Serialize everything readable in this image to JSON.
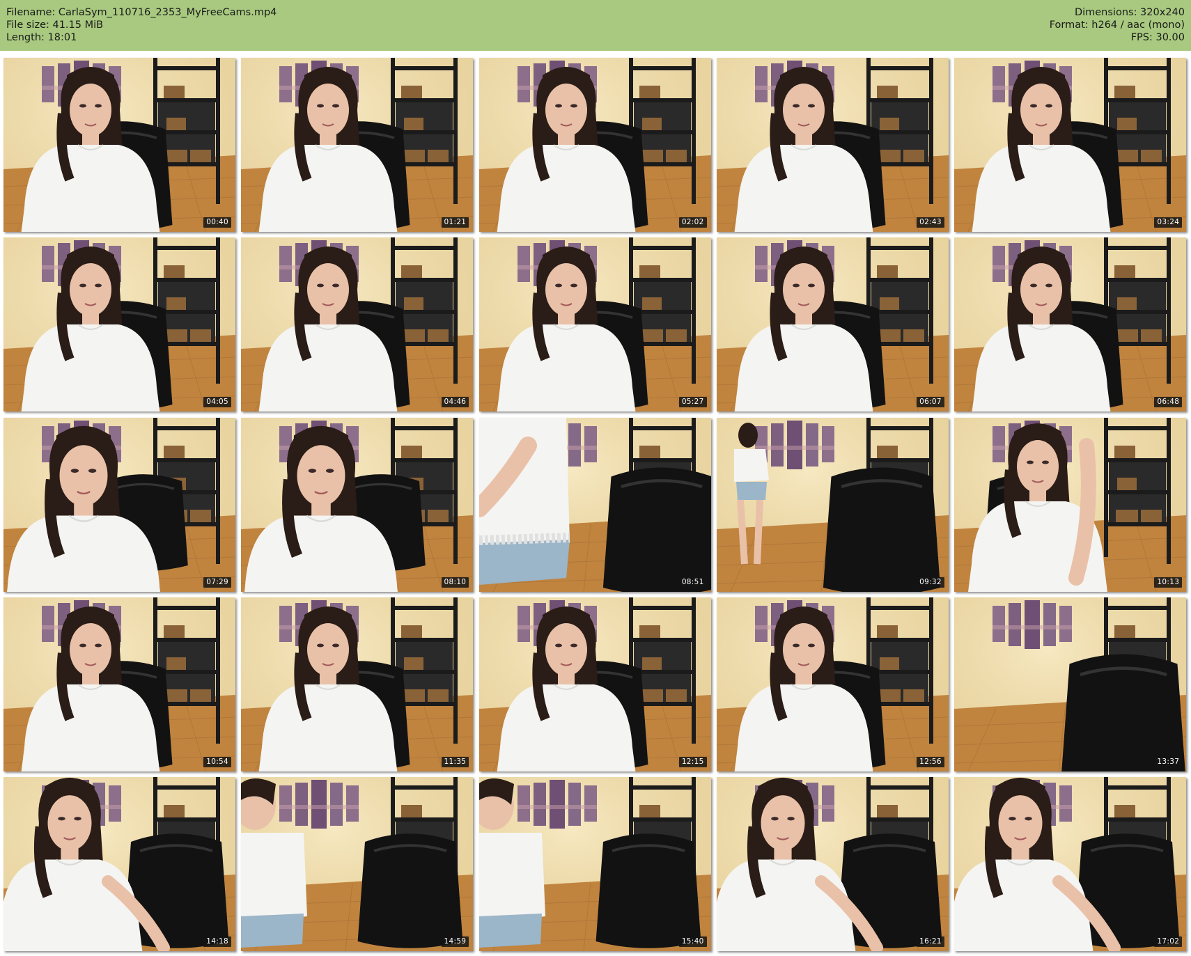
{
  "header": {
    "filename_line": "Filename: CarlaSym_110716_2353_MyFreeCams.mp4",
    "filesize_line": "File size: 41.15 MiB",
    "length_line": "Length: 18:01",
    "dimensions_line": "Dimensions: 320x240",
    "format_line": "Format: h264 / aac (mono)",
    "fps_line": "FPS: 30.00"
  },
  "colors": {
    "header_bg": "#a8c97f",
    "wall": "#ecd9a6",
    "floor": "#c0843f",
    "shelf": "#1b1b1b",
    "hair": "#2a1c16",
    "shirt": "#f4f4f2",
    "skin": "#e9c1a8",
    "chair": "#121212",
    "artwork": "#8d6f8c"
  },
  "thumbnails": [
    {
      "timestamp": "00:40",
      "scene": "seated"
    },
    {
      "timestamp": "01:21",
      "scene": "seated"
    },
    {
      "timestamp": "02:02",
      "scene": "seated"
    },
    {
      "timestamp": "02:43",
      "scene": "seated"
    },
    {
      "timestamp": "03:24",
      "scene": "seated"
    },
    {
      "timestamp": "04:05",
      "scene": "seated"
    },
    {
      "timestamp": "04:46",
      "scene": "seated"
    },
    {
      "timestamp": "05:27",
      "scene": "seated"
    },
    {
      "timestamp": "06:07",
      "scene": "seated"
    },
    {
      "timestamp": "06:48",
      "scene": "seated"
    },
    {
      "timestamp": "07:29",
      "scene": "seated-close"
    },
    {
      "timestamp": "08:10",
      "scene": "seated-close"
    },
    {
      "timestamp": "08:51",
      "scene": "standing-close"
    },
    {
      "timestamp": "09:32",
      "scene": "standing-far"
    },
    {
      "timestamp": "10:13",
      "scene": "seated-hand"
    },
    {
      "timestamp": "10:54",
      "scene": "seated"
    },
    {
      "timestamp": "11:35",
      "scene": "seated"
    },
    {
      "timestamp": "12:15",
      "scene": "seated"
    },
    {
      "timestamp": "12:56",
      "scene": "seated"
    },
    {
      "timestamp": "13:37",
      "scene": "empty-chair"
    },
    {
      "timestamp": "14:18",
      "scene": "leaning"
    },
    {
      "timestamp": "14:59",
      "scene": "leaning-side"
    },
    {
      "timestamp": "15:40",
      "scene": "leaning-side"
    },
    {
      "timestamp": "16:21",
      "scene": "leaning"
    },
    {
      "timestamp": "17:02",
      "scene": "leaning"
    }
  ]
}
